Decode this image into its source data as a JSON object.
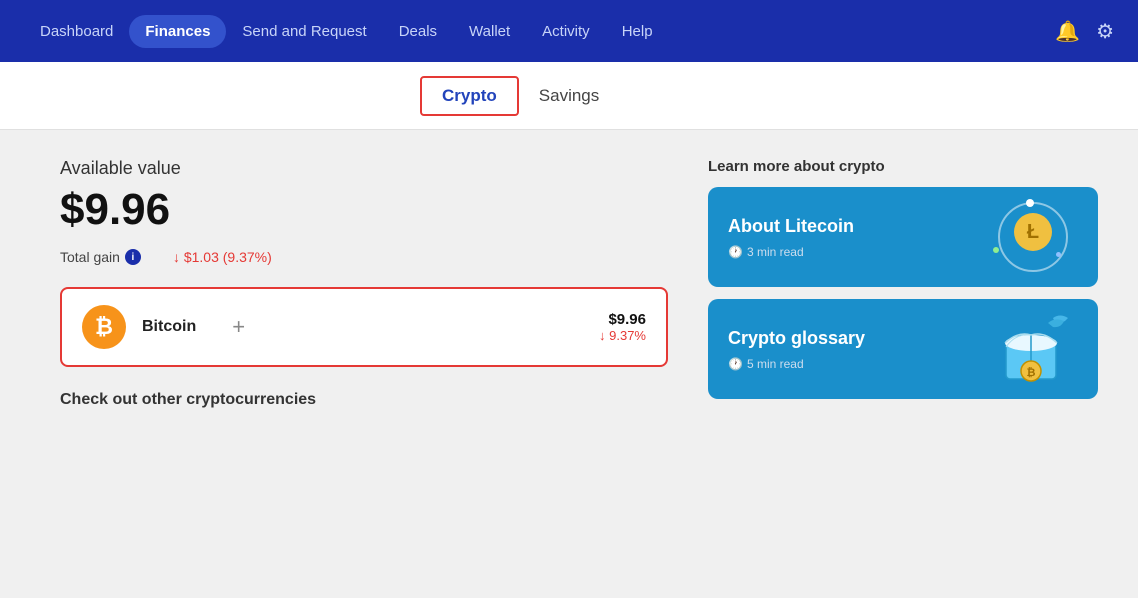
{
  "navbar": {
    "items": [
      {
        "label": "Dashboard",
        "active": false
      },
      {
        "label": "Finances",
        "active": true
      },
      {
        "label": "Send and Request",
        "active": false
      },
      {
        "label": "Deals",
        "active": false
      },
      {
        "label": "Wallet",
        "active": false
      },
      {
        "label": "Activity",
        "active": false
      },
      {
        "label": "Help",
        "active": false
      }
    ]
  },
  "tabs": {
    "items": [
      {
        "label": "Crypto",
        "active": true
      },
      {
        "label": "Savings",
        "active": false
      }
    ]
  },
  "main": {
    "available_label": "Available value",
    "available_value": "$9.96",
    "total_gain_label": "Total gain",
    "total_gain_value": "↓ $1.03 (9.37%)",
    "bitcoin": {
      "name": "Bitcoin",
      "amount": "$9.96",
      "percent": "↓ 9.37%"
    },
    "other_crypto_label": "Check out other cryptocurrencies"
  },
  "learn": {
    "title": "Learn more about crypto",
    "cards": [
      {
        "title": "About Litecoin",
        "meta": "3 min read"
      },
      {
        "title": "Crypto glossary",
        "meta": "5 min read"
      }
    ]
  },
  "icons": {
    "bell": "🔔",
    "gear": "⚙",
    "clock": "🕐",
    "info": "i",
    "down_arrow": "↓",
    "plus": "+",
    "bitcoin_symbol": "₿"
  }
}
